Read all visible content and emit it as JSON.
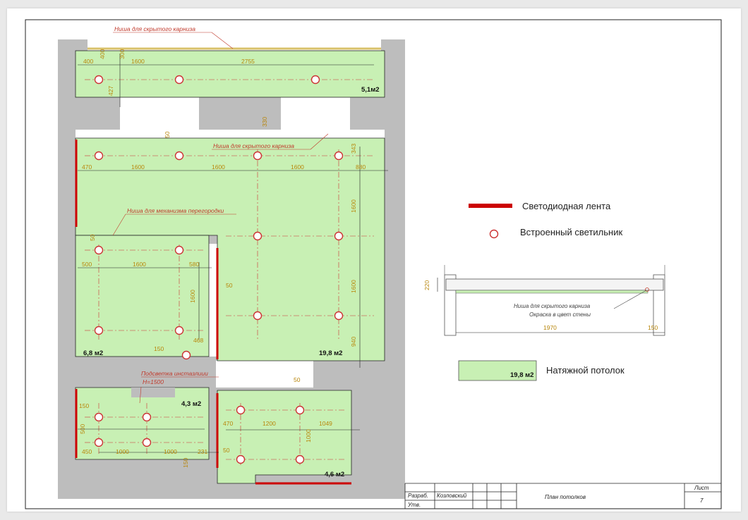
{
  "plan": {
    "notes": {
      "niche_top": "Ниша для скрытого карниза",
      "niche_mid": "Ниша для скрытого карниза",
      "partition": "Ниша для механизма перегородки",
      "install_light": "Подсветка инстазлиии",
      "install_height": "Н=1500"
    },
    "areas": {
      "top": "5,1м2",
      "big": "19,8 м2",
      "left": "6,8 м2",
      "bottom_left": "4,3 м2",
      "bottom_right": "4,6 м2"
    },
    "dims": {
      "t_400": "400",
      "t_1600": "1600",
      "t_2755": "2755",
      "t_427": "427",
      "t_400v": "400",
      "t_300v": "300",
      "t_330": "330",
      "t_50": "50",
      "b_470": "470",
      "b_1600a": "1600",
      "b_1600b": "1600",
      "b_1600c": "1600",
      "b_343": "343",
      "b_880": "880",
      "b_1600v1": "1600",
      "b_1600v2": "1600",
      "b_940": "940",
      "l_500": "500",
      "l_1600": "1600",
      "l_580": "580",
      "l_1600v": "1600",
      "l_50": "50",
      "l_150": "150",
      "l_468": "468",
      "l_50v": "50",
      "bl_150": "150",
      "bl_500": "500",
      "bl_450": "450",
      "bl_1000a": "1000",
      "bl_1000b": "1000",
      "bl_231": "231",
      "bl_150b": "150",
      "br_50": "50",
      "br_470": "470",
      "br_1200": "1200",
      "br_1049": "1049",
      "br_1000": "1000",
      "br_50b": "50"
    }
  },
  "legend": {
    "led_label": "Светодиодная лента",
    "light_label": "Встроенный светильник",
    "ceiling_label": "Натяжной потолок",
    "ceiling_area": "19,8 м2",
    "led_color": "#cc0000",
    "fill_color": "#c8f0b4"
  },
  "section": {
    "dim_height": "220",
    "dim_1970": "1970",
    "dim_150": "150",
    "note1": "Ниша для скрытого карниза",
    "note2": "Окраска в цвет стены"
  },
  "title_block": {
    "row1_label": "Разраб.",
    "row1_name": "Козловский",
    "row2_label": "Утв.",
    "sheet_title": "План потолков",
    "sheet_label": "Лист",
    "sheet_number": "7"
  }
}
